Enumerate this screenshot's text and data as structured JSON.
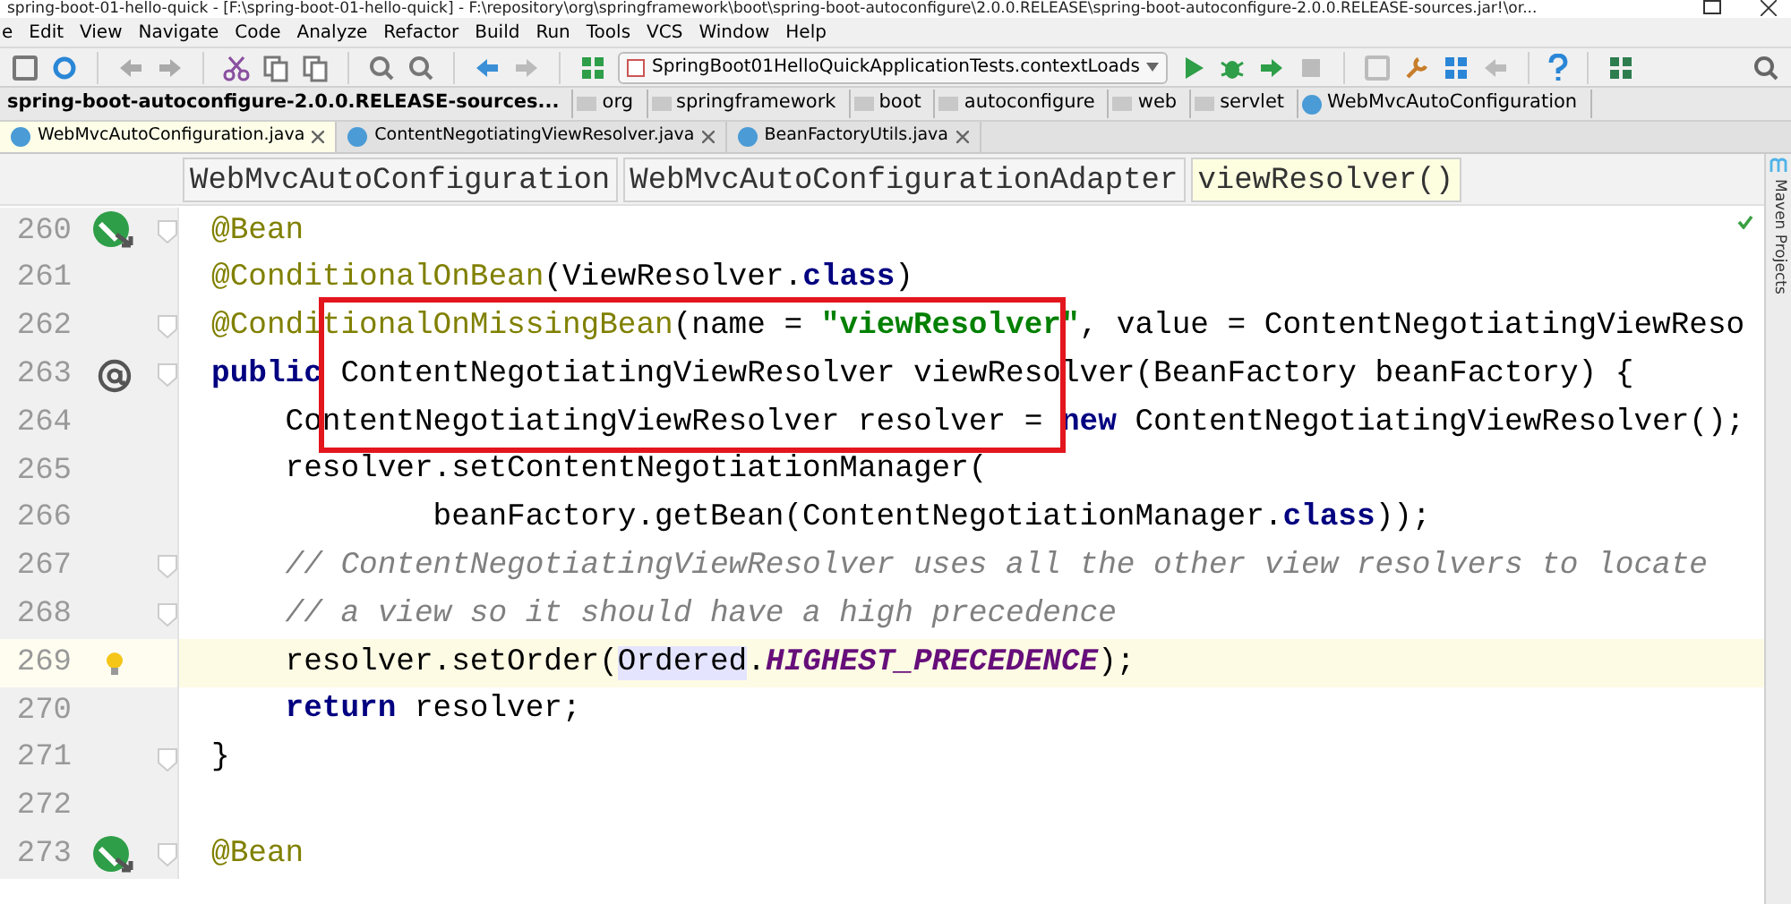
{
  "window": {
    "title": "spring-boot-01-hello-quick - [F:\\spring-boot-01-hello-quick] - F:\\repository\\org\\springframework\\boot\\spring-boot-autoconfigure\\2.0.0.RELEASE\\spring-boot-autoconfigure-2.0.0.RELEASE-sources.jar!\\or..."
  },
  "menu": [
    "e",
    "Edit",
    "View",
    "Navigate",
    "Code",
    "Analyze",
    "Refactor",
    "Build",
    "Run",
    "Tools",
    "VCS",
    "Window",
    "Help"
  ],
  "run_config": "SpringBoot01HelloQuickApplicationTests.contextLoads",
  "breadcrumb": [
    {
      "label": "spring-boot-autoconfigure-2.0.0.RELEASE-sources...",
      "kind": "root"
    },
    {
      "label": "org",
      "kind": "folder"
    },
    {
      "label": "springframework",
      "kind": "folder"
    },
    {
      "label": "boot",
      "kind": "folder"
    },
    {
      "label": "autoconfigure",
      "kind": "folder"
    },
    {
      "label": "web",
      "kind": "folder"
    },
    {
      "label": "servlet",
      "kind": "folder"
    },
    {
      "label": "WebMvcAutoConfiguration",
      "kind": "class"
    }
  ],
  "tabs": [
    {
      "label": "WebMvcAutoConfiguration.java",
      "selected": true
    },
    {
      "label": "ContentNegotiatingViewResolver.java",
      "selected": false
    },
    {
      "label": "BeanFactoryUtils.java",
      "selected": false
    }
  ],
  "structure": [
    {
      "label": "WebMvcAutoConfiguration",
      "selected": false
    },
    {
      "label": "WebMvcAutoConfigurationAdapter",
      "selected": false
    },
    {
      "label": "viewResolver()",
      "selected": true
    }
  ],
  "side_panel": "Maven Projects",
  "lines": [
    {
      "number": "260",
      "kind": "bean",
      "fold": true,
      "current": false,
      "tokens": [
        {
          "t": "@Bean",
          "kind": "annotation"
        }
      ]
    },
    {
      "number": "261",
      "kind": "plain",
      "fold": false,
      "current": false,
      "tokens": [
        {
          "t": "@ConditionalOnBean",
          "kind": "annotation"
        },
        {
          "t": "(ViewResolver.",
          "kind": "plain"
        },
        {
          "t": "class",
          "kind": "keyword"
        },
        {
          "t": ")",
          "kind": "plain"
        }
      ]
    },
    {
      "number": "262",
      "kind": "plain",
      "fold": true,
      "current": false,
      "tokens": [
        {
          "t": "@ConditionalOnMissingBean",
          "kind": "annotation"
        },
        {
          "t": "(name = ",
          "kind": "plain"
        },
        {
          "t": "\"viewResolver\"",
          "kind": "string"
        },
        {
          "t": ", value = ContentNegotiatingViewReso",
          "kind": "plain"
        }
      ]
    },
    {
      "number": "263",
      "kind": "override",
      "fold": true,
      "current": false,
      "tokens": [
        {
          "t": "public",
          "kind": "keyword"
        },
        {
          "t": " ContentNegotiatingViewResolver viewResolver(BeanFactory beanFactory) {",
          "kind": "plain"
        }
      ]
    },
    {
      "number": "264",
      "kind": "plain",
      "fold": false,
      "current": false,
      "tokens": [
        {
          "t": "    ContentNegotiatingViewResolver resolver = ",
          "kind": "plain"
        },
        {
          "t": "new",
          "kind": "keyword"
        },
        {
          "t": " ContentNegotiatingViewResolver();",
          "kind": "plain"
        }
      ]
    },
    {
      "number": "265",
      "kind": "plain",
      "fold": false,
      "current": false,
      "tokens": [
        {
          "t": "    resolver.setContentNegotiationManager(",
          "kind": "plain"
        }
      ]
    },
    {
      "number": "266",
      "kind": "plain",
      "fold": false,
      "current": false,
      "tokens": [
        {
          "t": "            beanFactory.getBean(ContentNegotiationManager.",
          "kind": "plain"
        },
        {
          "t": "class",
          "kind": "keyword"
        },
        {
          "t": "));",
          "kind": "plain"
        }
      ]
    },
    {
      "number": "267",
      "kind": "plain",
      "fold": true,
      "current": false,
      "tokens": [
        {
          "t": "    // ContentNegotiatingViewResolver uses all the other view resolvers to locate",
          "kind": "comment"
        }
      ]
    },
    {
      "number": "268",
      "kind": "plain",
      "fold": true,
      "current": false,
      "tokens": [
        {
          "t": "    // a view so it should have a high precedence",
          "kind": "comment"
        }
      ]
    },
    {
      "number": "269",
      "kind": "bulb",
      "fold": false,
      "current": true,
      "tokens": [
        {
          "t": "    resolver.setOrder(",
          "kind": "plain"
        },
        {
          "t": "Ordered",
          "kind": "usage"
        },
        {
          "t": ".",
          "kind": "plain"
        },
        {
          "t": "HIGHEST_PRECEDENCE",
          "kind": "static"
        },
        {
          "t": ");",
          "kind": "plain"
        }
      ]
    },
    {
      "number": "270",
      "kind": "plain",
      "fold": false,
      "current": false,
      "tokens": [
        {
          "t": "    return",
          "kind": "keyword"
        },
        {
          "t": " resolver;",
          "kind": "plain"
        }
      ]
    },
    {
      "number": "271",
      "kind": "plain",
      "fold": true,
      "current": false,
      "tokens": [
        {
          "t": "}",
          "kind": "plain"
        }
      ]
    },
    {
      "number": "272",
      "kind": "plain",
      "fold": false,
      "current": false
    },
    {
      "number": "273",
      "kind": "bean",
      "fold": true,
      "current": false,
      "tokens": [
        {
          "t": "@Bean",
          "kind": "annotation"
        }
      ]
    }
  ]
}
